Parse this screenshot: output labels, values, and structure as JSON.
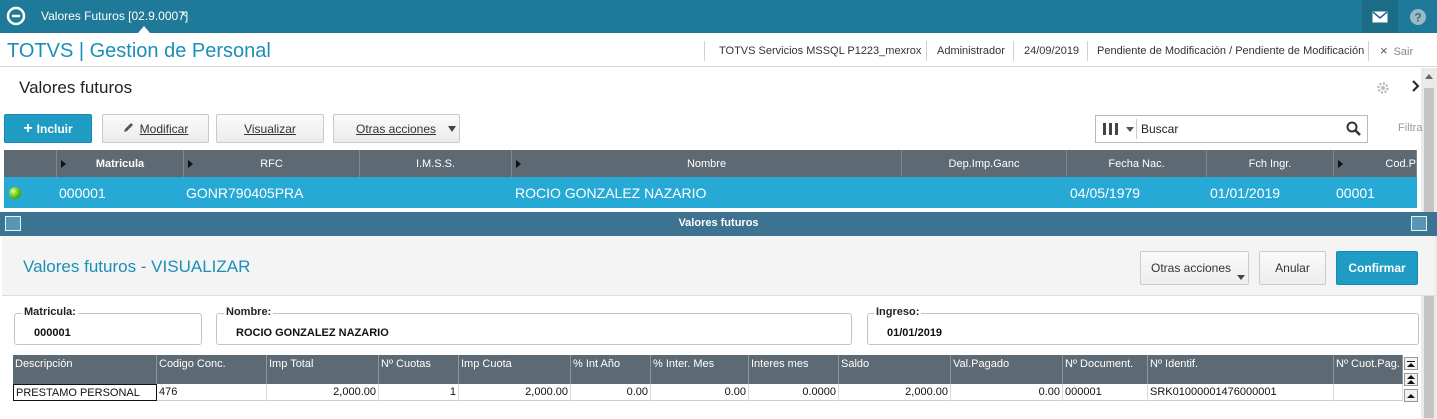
{
  "topbar": {
    "tab_label": "Valores Futuros [02.9.0007]",
    "tab_close": "×",
    "icons": [
      "logo-icon",
      "mail-icon",
      "help-icon"
    ]
  },
  "header": {
    "app_title": "TOTVS | Gestion de Personal",
    "environment": "TOTVS Servicios MSSQL P1223_mexrox",
    "user": "Administrador",
    "date": "24/09/2019",
    "status": "Pendiente de Modificación / Pendiente de Modificación",
    "exit_label": "Sair",
    "exit_icon": "×"
  },
  "page": {
    "title": "Valores futuros"
  },
  "toolbar": {
    "include_label": "Incluir",
    "include_icon": "+",
    "modify_label": "Modificar",
    "view_label": "Visualizar",
    "other_actions_label": "Otras acciones",
    "search_value": "Buscar",
    "filter_label": "Filtra"
  },
  "browse": {
    "columns": [
      "Matricula",
      "RFC",
      "I.M.S.S.",
      "Nombre",
      "Dep.Imp.Ganc",
      "Fecha Nac.",
      "Fch Ingr.",
      "Cod.P"
    ],
    "row": {
      "matricula": "000001",
      "rfc": "GONR790405PRA",
      "imss": "",
      "nombre": "ROCIO  GONZALEZ NAZARIO",
      "dep_imp_ganc": "",
      "fecha_nac": "04/05/1979",
      "fch_ingr": "01/01/2019",
      "cod_p": "00001"
    },
    "status_color": "#52b800"
  },
  "modal": {
    "bar_title": "Valores futuros",
    "title": "Valores futuros - VISUALIZAR",
    "other_actions_label": "Otras acciones",
    "cancel_label": "Anular",
    "confirm_label": "Confirmar",
    "fields": {
      "matricula_label": "Matricula:",
      "matricula_value": "000001",
      "nombre_label": "Nombre:",
      "nombre_value": "ROCIO  GONZALEZ NAZARIO",
      "ingreso_label": "Ingreso:",
      "ingreso_value": "01/01/2019"
    },
    "detail": {
      "columns": [
        "Descripción",
        "Codigo Conc.",
        "Imp Total",
        "Nº Cuotas",
        "Imp Cuota",
        "% Int Año",
        "% Inter. Mes",
        "Interes mes",
        "Saldo",
        "Val.Pagado",
        "Nº Document.",
        "Nº Identif.",
        "Nº Cuot.Pag."
      ],
      "row": [
        "PRESTAMO PERSONAL",
        "476",
        "2,000.00",
        "1",
        "2,000.00",
        "0.00",
        "0.00",
        "0.0000",
        "2,000.00",
        "0.00",
        "000001",
        "SRK01000001476000001",
        ""
      ]
    }
  },
  "colors": {
    "topbar": "#1f7a99",
    "accent": "#1a8fb8",
    "selected_row": "#27a9d6",
    "grid_header": "#5d6a74",
    "primary_button": "#1f9cc4"
  }
}
